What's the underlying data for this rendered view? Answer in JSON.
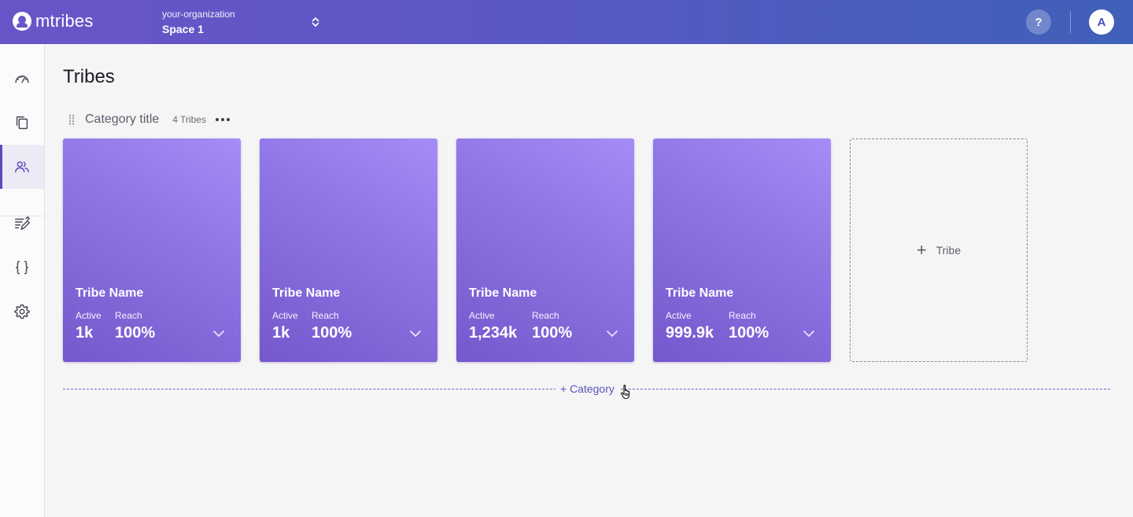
{
  "header": {
    "logo_text": "mtribes",
    "organization": "your-organization",
    "space": "Space 1",
    "help_label": "?",
    "avatar_initial": "A"
  },
  "sidebar": {
    "items": [
      {
        "icon": "dashboard-gauge-icon",
        "active": false
      },
      {
        "icon": "copy-icon",
        "active": false
      },
      {
        "icon": "users-icon",
        "active": true
      },
      {
        "icon": "edit-list-icon",
        "active": false
      },
      {
        "icon": "code-braces-icon",
        "active": false
      },
      {
        "icon": "gear-icon",
        "active": false
      }
    ]
  },
  "main": {
    "title": "Tribes",
    "category": {
      "title": "Category title",
      "count": "4 Tribes"
    },
    "tribes": [
      {
        "name": "Tribe Name",
        "active_label": "Active",
        "active_value": "1k",
        "reach_label": "Reach",
        "reach_value": "100%"
      },
      {
        "name": "Tribe Name",
        "active_label": "Active",
        "active_value": "1k",
        "reach_label": "Reach",
        "reach_value": "100%"
      },
      {
        "name": "Tribe Name",
        "active_label": "Active",
        "active_value": "1,234k",
        "reach_label": "Reach",
        "reach_value": "100%"
      },
      {
        "name": "Tribe Name",
        "active_label": "Active",
        "active_value": "999.9k",
        "reach_label": "Reach",
        "reach_value": "100%"
      }
    ],
    "add_tribe_plus": "+",
    "add_tribe_label": "Tribe",
    "add_category_label": "+ Category"
  },
  "colors": {
    "accent": "#5b4bbf",
    "card_gradient_start": "#a68cf6",
    "card_gradient_end": "#7558cc"
  }
}
